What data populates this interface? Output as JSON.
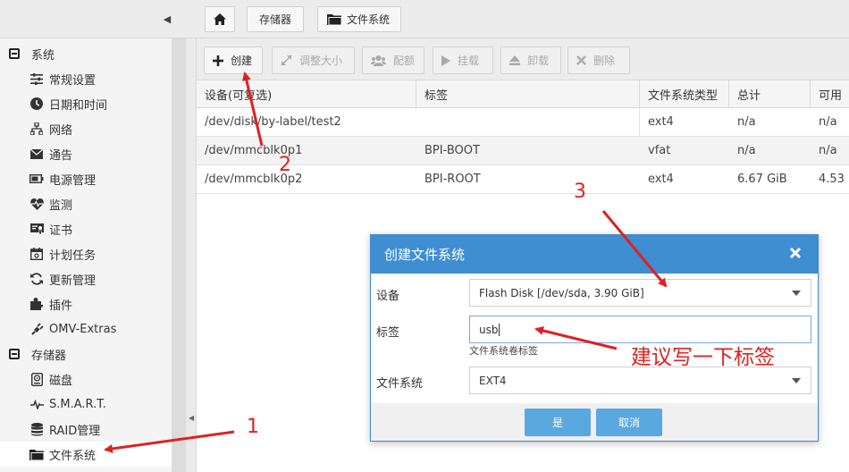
{
  "breadcrumbs": [
    {
      "label": ""
    },
    {
      "label": "存储器"
    },
    {
      "label": "文件系统"
    }
  ],
  "sidebar": {
    "items": [
      {
        "label": "系统",
        "type": "group",
        "icon": "collapse-icon"
      },
      {
        "label": "常规设置",
        "type": "leaf",
        "icon": "sliders-icon"
      },
      {
        "label": "日期和时间",
        "type": "leaf",
        "icon": "clock-icon"
      },
      {
        "label": "网络",
        "type": "leaf",
        "icon": "network-icon"
      },
      {
        "label": "通告",
        "type": "leaf",
        "icon": "envelope-icon"
      },
      {
        "label": "电源管理",
        "type": "leaf",
        "icon": "battery-icon"
      },
      {
        "label": "监测",
        "type": "leaf",
        "icon": "heartbeat-icon"
      },
      {
        "label": "证书",
        "type": "leaf",
        "icon": "certificate-icon"
      },
      {
        "label": "计划任务",
        "type": "leaf",
        "icon": "calendar-icon"
      },
      {
        "label": "更新管理",
        "type": "leaf",
        "icon": "refresh-icon"
      },
      {
        "label": "插件",
        "type": "leaf",
        "icon": "puzzle-icon"
      },
      {
        "label": "OMV-Extras",
        "type": "leaf",
        "icon": "plug-icon"
      },
      {
        "label": "存储器",
        "type": "group",
        "icon": "collapse-icon"
      },
      {
        "label": "磁盘",
        "type": "leaf",
        "icon": "disk-icon"
      },
      {
        "label": "S.M.A.R.T.",
        "type": "leaf",
        "icon": "pulse-icon"
      },
      {
        "label": "RAID管理",
        "type": "leaf",
        "icon": "database-icon"
      },
      {
        "label": "文件系统",
        "type": "leaf",
        "icon": "folder-icon",
        "active": true
      }
    ]
  },
  "toolbar": {
    "create": "创建",
    "resize": "调整大小",
    "quota": "配额",
    "mount": "挂载",
    "unmount": "卸载",
    "delete": "删除"
  },
  "grid": {
    "columns": [
      "设备(可复选)",
      "标签",
      "文件系统类型",
      "总计",
      "可用"
    ],
    "rows": [
      [
        "/dev/disk/by-label/test2",
        "",
        "ext4",
        "n/a",
        "n/a"
      ],
      [
        "/dev/mmcblk0p1",
        "BPI-BOOT",
        "vfat",
        "n/a",
        "n/a"
      ],
      [
        "/dev/mmcblk0p2",
        "BPI-ROOT",
        "ext4",
        "6.67 GiB",
        "4.53"
      ]
    ]
  },
  "dialog": {
    "title": "创建文件系统",
    "device_label": "设备",
    "device_value": "Flash Disk [/dev/sda, 3.90 GiB]",
    "label_label": "标签",
    "label_value": "usb",
    "label_hint": "文件系统卷标签",
    "fs_label": "文件系统",
    "fs_value": "EXT4",
    "ok": "是",
    "cancel": "取消"
  },
  "annotations": {
    "step1": "1",
    "step2": "2",
    "step3": "3",
    "note": "建议写一下标签",
    "color": "#e02020"
  }
}
